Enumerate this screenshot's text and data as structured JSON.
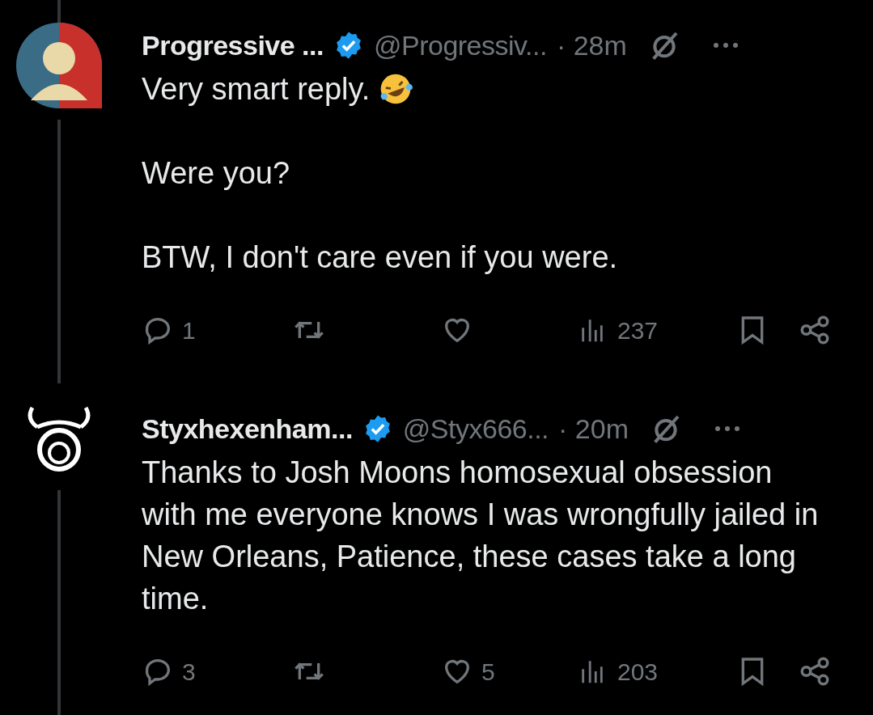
{
  "posts": [
    {
      "avatar": {
        "kind": "person"
      },
      "name": "Progressive ...",
      "verified": true,
      "handle": "@Progressiv...",
      "time": "· 28m",
      "body": [
        "Very smart reply.",
        "Were you?",
        "BTW, I don't care even if you were."
      ],
      "emoji_after_first": true,
      "replies": "1",
      "views": "237"
    },
    {
      "avatar": {
        "kind": "symbol"
      },
      "name": "Styxhexenham...",
      "verified": true,
      "handle": "@Styx666...",
      "time": "· 20m",
      "body": [
        "Thanks to Josh Moons homosexual obsession with me everyone knows I was wrongfully jailed in New Orleans, Patience, these cases take a long time."
      ],
      "emoji_after_first": false,
      "replies": "3",
      "likes": "5",
      "views": "203"
    }
  ]
}
